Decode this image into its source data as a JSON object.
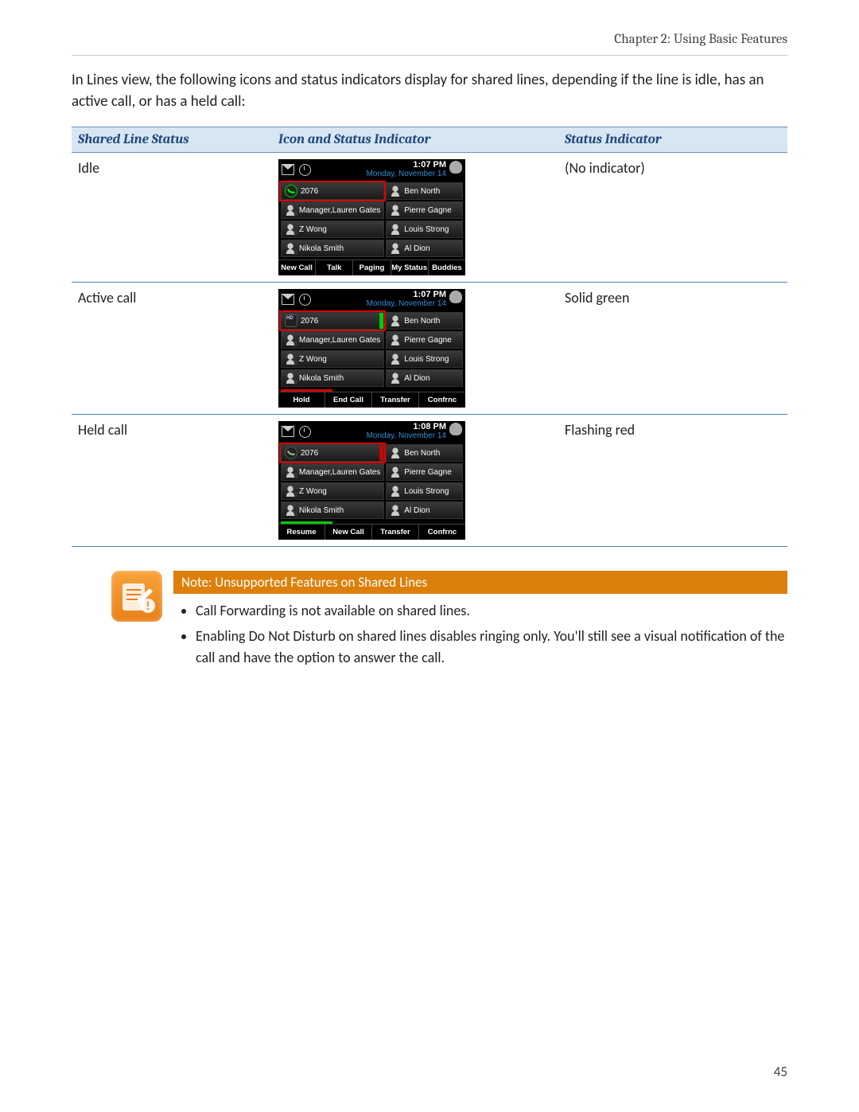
{
  "header": {
    "chapter": "Chapter 2: Using Basic Features"
  },
  "intro": "In Lines view, the following icons and status indicators display for shared lines, depending if the line is idle, has an active call, or has a held call:",
  "table": {
    "headers": [
      "Shared Line Status",
      "Icon and Status Indicator",
      "Status Indicator"
    ],
    "rows": [
      {
        "status": "Idle",
        "indicator": "(No indicator)",
        "phone": {
          "time": "1:07 PM",
          "date": "Monday, November 14",
          "first_icon": "phone-green",
          "first_label": "2076",
          "highlight": true,
          "bar": "",
          "contacts": [
            {
              "icon": "personx",
              "label": "Manager,Lauren Gates"
            },
            {
              "icon": "personx",
              "label": "Z Wong"
            },
            {
              "icon": "personx",
              "label": "Nikola Smith"
            },
            {
              "icon": "person",
              "label": "Ben North"
            },
            {
              "icon": "person",
              "label": "Pierre Gagne"
            },
            {
              "icon": "person",
              "label": "Louis Strong"
            },
            {
              "icon": "person",
              "label": "Al Dion"
            }
          ],
          "softkeys": [
            "New Call",
            "Talk",
            "Paging",
            "My Status",
            "Buddies"
          ],
          "underbar": ""
        }
      },
      {
        "status": "Active call",
        "indicator": "Solid green",
        "phone": {
          "time": "1:07 PM",
          "date": "Monday, November 14",
          "first_icon": "hd",
          "first_label": "2076",
          "highlight": true,
          "bar": "green",
          "contacts": [
            {
              "icon": "personx",
              "label": "Manager,Lauren Gates"
            },
            {
              "icon": "personx",
              "label": "Z Wong"
            },
            {
              "icon": "personx",
              "label": "Nikola Smith"
            },
            {
              "icon": "person",
              "label": "Ben North"
            },
            {
              "icon": "person",
              "label": "Pierre Gagne"
            },
            {
              "icon": "person",
              "label": "Louis Strong"
            },
            {
              "icon": "person",
              "label": "Al Dion"
            }
          ],
          "softkeys": [
            "Hold",
            "End Call",
            "Transfer",
            "Confrnc"
          ],
          "underbar": "red"
        }
      },
      {
        "status": "Held call",
        "indicator": "Flashing red",
        "phone": {
          "time": "1:08 PM",
          "date": "Monday, November 14",
          "first_icon": "phone",
          "first_label": "2076",
          "highlight": true,
          "bar": "red",
          "contacts": [
            {
              "icon": "personx",
              "label": "Manager,Lauren Gates"
            },
            {
              "icon": "personx",
              "label": "Z Wong"
            },
            {
              "icon": "personx",
              "label": "Nikola Smith"
            },
            {
              "icon": "person",
              "label": "Ben North"
            },
            {
              "icon": "person",
              "label": "Pierre Gagne"
            },
            {
              "icon": "person",
              "label": "Louis Strong"
            },
            {
              "icon": "person",
              "label": "Al Dion"
            }
          ],
          "softkeys": [
            "Resume",
            "New Call",
            "Transfer",
            "Confrnc"
          ],
          "underbar": "green"
        }
      }
    ]
  },
  "note": {
    "title": "Note: Unsupported Features on Shared Lines",
    "items": [
      "Call Forwarding is not available on shared lines.",
      "Enabling Do Not Disturb on shared lines disables ringing only. You'll still see a visual notification of the call and have the option to answer the call."
    ]
  },
  "page_number": "45"
}
